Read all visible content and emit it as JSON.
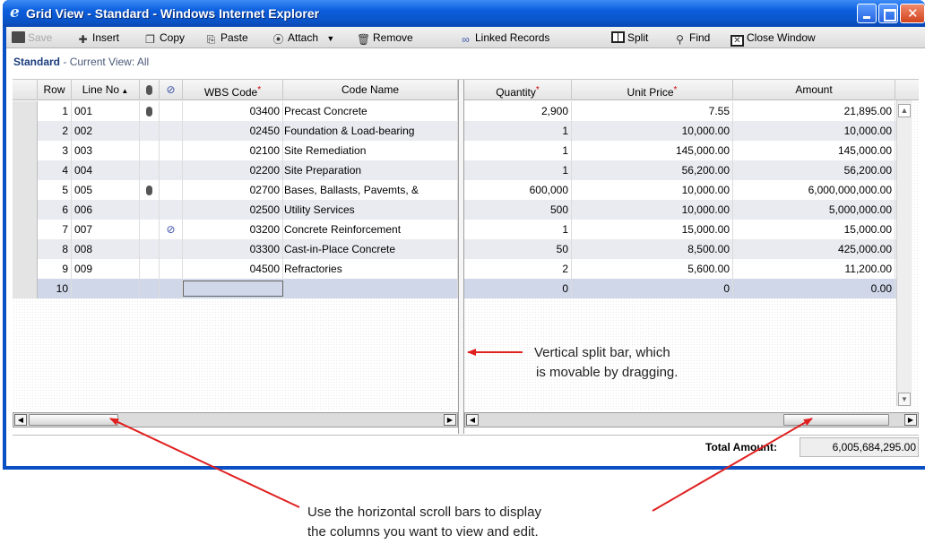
{
  "window": {
    "title": "Grid View - Standard - Windows Internet Explorer",
    "icon": "ie-icon"
  },
  "toolbar": {
    "save": "Save",
    "insert": "Insert",
    "copy": "Copy",
    "paste": "Paste",
    "attach": "Attach",
    "remove": "Remove",
    "linked_records": "Linked Records",
    "split": "Split",
    "find": "Find",
    "close_window": "Close Window"
  },
  "view": {
    "name": "Standard",
    "current_view": "- Current View:  All"
  },
  "left_columns": {
    "row": "Row",
    "line_no": "Line No",
    "wbs_code": "WBS Code",
    "code_name": "Code Name"
  },
  "right_columns": {
    "quantity": "Quantity",
    "unit_price": "Unit Price",
    "amount": "Amount"
  },
  "rows": [
    {
      "row": "1",
      "line_no": "001",
      "attach": true,
      "link": false,
      "wbs": "03400",
      "name": "Precast Concrete",
      "quantity": "2,900",
      "unit_price": "7.55",
      "amount": "21,895.00"
    },
    {
      "row": "2",
      "line_no": "002",
      "attach": false,
      "link": false,
      "wbs": "02450",
      "name": "Foundation & Load-bearing",
      "quantity": "1",
      "unit_price": "10,000.00",
      "amount": "10,000.00"
    },
    {
      "row": "3",
      "line_no": "003",
      "attach": false,
      "link": false,
      "wbs": "02100",
      "name": "Site Remediation",
      "quantity": "1",
      "unit_price": "145,000.00",
      "amount": "145,000.00"
    },
    {
      "row": "4",
      "line_no": "004",
      "attach": false,
      "link": false,
      "wbs": "02200",
      "name": "Site Preparation",
      "quantity": "1",
      "unit_price": "56,200.00",
      "amount": "56,200.00"
    },
    {
      "row": "5",
      "line_no": "005",
      "attach": true,
      "link": false,
      "wbs": "02700",
      "name": "Bases, Ballasts, Pavemts, &",
      "quantity": "600,000",
      "unit_price": "10,000.00",
      "amount": "6,000,000,000.00"
    },
    {
      "row": "6",
      "line_no": "006",
      "attach": false,
      "link": false,
      "wbs": "02500",
      "name": "Utility Services",
      "quantity": "500",
      "unit_price": "10,000.00",
      "amount": "5,000,000.00"
    },
    {
      "row": "7",
      "line_no": "007",
      "attach": false,
      "link": true,
      "wbs": "03200",
      "name": "Concrete Reinforcement",
      "quantity": "1",
      "unit_price": "15,000.00",
      "amount": "15,000.00"
    },
    {
      "row": "8",
      "line_no": "008",
      "attach": false,
      "link": false,
      "wbs": "03300",
      "name": "Cast-in-Place Concrete",
      "quantity": "50",
      "unit_price": "8,500.00",
      "amount": "425,000.00"
    },
    {
      "row": "9",
      "line_no": "009",
      "attach": false,
      "link": false,
      "wbs": "04500",
      "name": "Refractories",
      "quantity": "2",
      "unit_price": "5,600.00",
      "amount": "11,200.00"
    },
    {
      "row": "10",
      "line_no": "",
      "attach": false,
      "link": false,
      "wbs": "",
      "name": "",
      "quantity": "0",
      "unit_price": "0",
      "amount": "0.00"
    }
  ],
  "totals": {
    "label": "Total Amount:",
    "value": "6,005,684,295.00"
  },
  "annotations": {
    "split_bar_line1": "Vertical split bar, which",
    "split_bar_line2": "is movable by dragging.",
    "scroll_line1": "Use the horizontal scroll bars to display",
    "scroll_line2": "the columns you want to view and edit."
  },
  "colors": {
    "title_bar": "#0b5ddc",
    "arrow": "#e02020",
    "selected_row": "#cfd7e8",
    "required_marker": "#d00000"
  }
}
